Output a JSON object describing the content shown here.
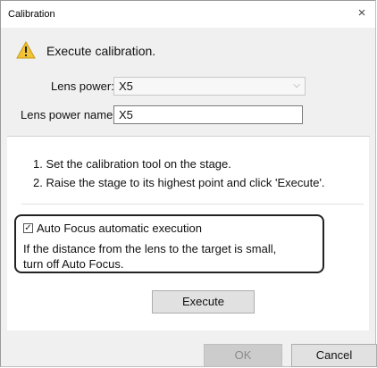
{
  "window": {
    "title": "Calibration",
    "close_glyph": "×"
  },
  "header": {
    "icon": "warning-icon",
    "text": "Execute calibration."
  },
  "lens_power": {
    "label": "Lens power:",
    "value": "X5"
  },
  "lens_power_name": {
    "label": "Lens power name:",
    "value": "X5"
  },
  "instructions": [
    "1. Set the calibration tool on the stage.",
    "2. Raise the stage to its highest point and click 'Execute'."
  ],
  "auto_focus": {
    "checked": true,
    "label": "Auto Focus automatic execution",
    "description_line1": "If the distance from the lens to the target is small,",
    "description_line2": "turn off Auto Focus."
  },
  "buttons": {
    "execute": "Execute",
    "ok": "OK",
    "cancel": "Cancel"
  },
  "colors": {
    "warning": "#f2c335",
    "dialog_bg": "#f0f0f0",
    "disabled_text": "#8a8a8a"
  }
}
